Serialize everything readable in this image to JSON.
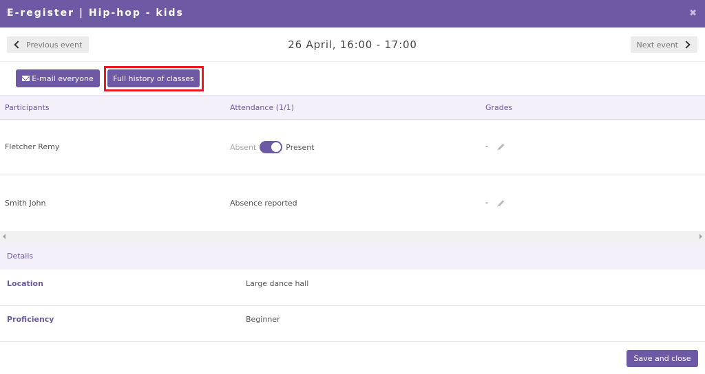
{
  "window": {
    "title": "E-register | Hip-hop - kids",
    "close_symbol": "✖"
  },
  "nav": {
    "prev_label": "Previous event",
    "date": "26 April, 16:00 - 17:00",
    "next_label": "Next event"
  },
  "actions": {
    "email_label": "E-mail everyone",
    "history_label": "Full history of classes"
  },
  "table": {
    "headers": {
      "participants": "Participants",
      "attendance": "Attendance (1/1)",
      "grades": "Grades"
    },
    "rows": [
      {
        "name": "Fletcher Remy",
        "absent_label": "Absent",
        "present_label": "Present",
        "grade": "-"
      },
      {
        "name": "Smith John",
        "attendance": "Absence reported",
        "grade": "-"
      }
    ]
  },
  "details": {
    "title": "Details",
    "rows": [
      {
        "label": "Location",
        "value": "Large dance hall"
      },
      {
        "label": "Proficiency",
        "value": "Beginner"
      }
    ]
  },
  "footer": {
    "save_label": "Save and close"
  },
  "colors": {
    "accent": "#6e59a5",
    "highlight": "#e8191f",
    "header_bg": "#f3f0fa"
  }
}
